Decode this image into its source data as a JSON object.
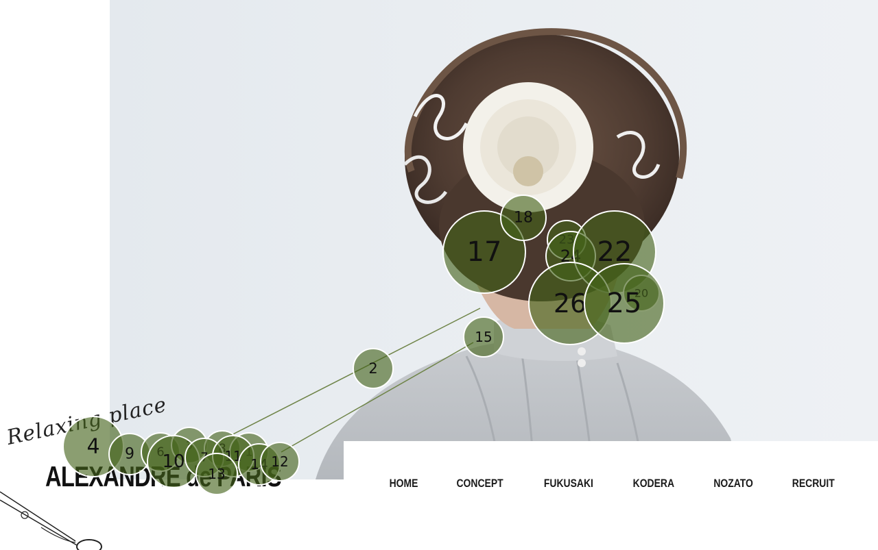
{
  "logo": {
    "tagline": "Relaxing place",
    "title": "ALEXANDRE de PARIS"
  },
  "nav": {
    "items": [
      {
        "label": "HOME"
      },
      {
        "label": "CONCEPT"
      },
      {
        "label": "FUKUSAKI"
      },
      {
        "label": "KODERA"
      },
      {
        "label": "NOZATO"
      },
      {
        "label": "RECRUIT"
      }
    ]
  },
  "markers": [
    {
      "label": "4"
    },
    {
      "label": "9"
    },
    {
      "label": "6"
    },
    {
      "label": "3"
    },
    {
      "label": "10"
    },
    {
      "label": "8"
    },
    {
      "label": "7"
    },
    {
      "label": "1"
    },
    {
      "label": "11"
    },
    {
      "label": "13"
    },
    {
      "label": "14"
    },
    {
      "label": "12"
    },
    {
      "label": "2"
    },
    {
      "label": "15"
    },
    {
      "label": "17"
    },
    {
      "label": "18"
    },
    {
      "label": "23"
    },
    {
      "label": "24"
    },
    {
      "label": "22"
    },
    {
      "label": "20"
    },
    {
      "label": "26"
    },
    {
      "label": "25"
    }
  ],
  "colors": {
    "marker_fill": "#44621a",
    "marker_stroke": "#ffffff",
    "hero_background": "#e7ebef",
    "nav_text": "#1a1a1a"
  }
}
